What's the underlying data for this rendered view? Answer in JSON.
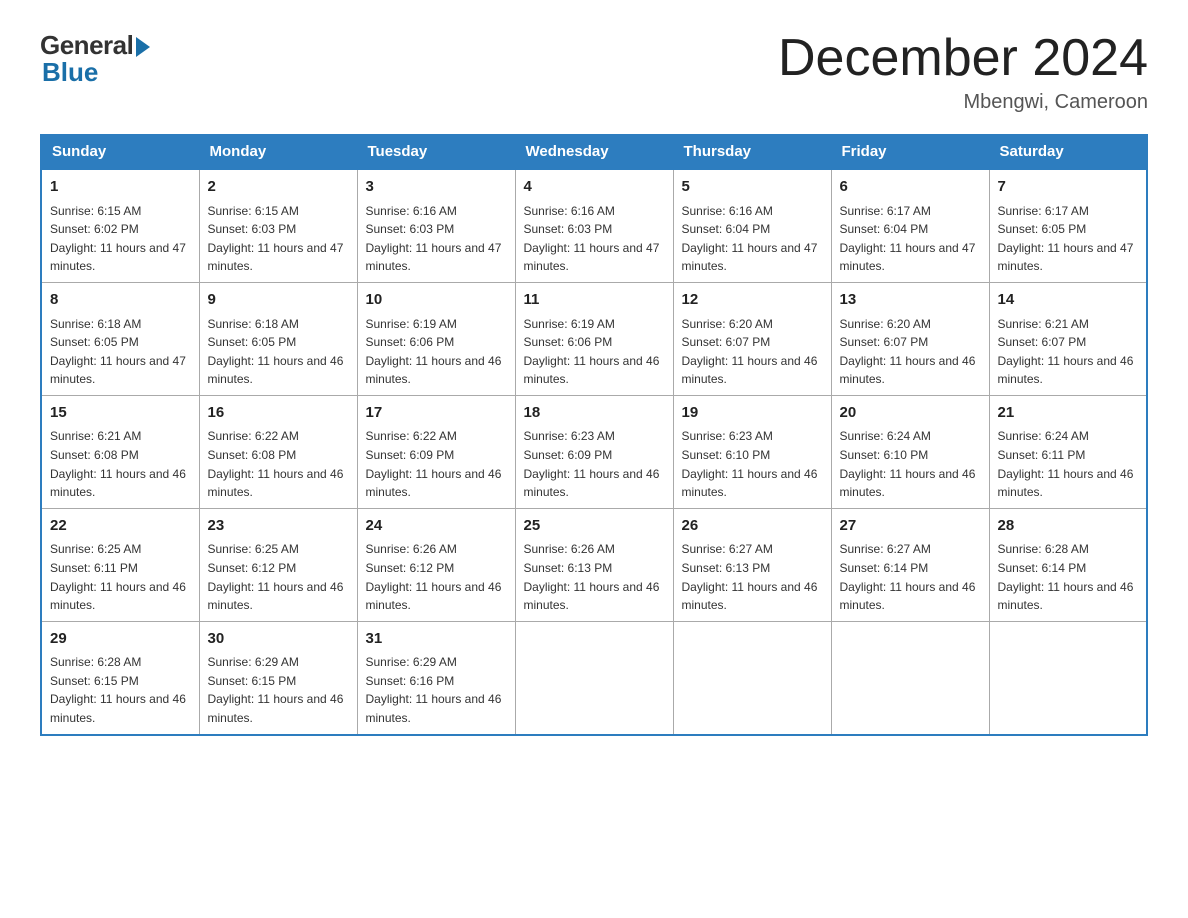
{
  "header": {
    "logo_general": "General",
    "logo_blue": "Blue",
    "month_title": "December 2024",
    "location": "Mbengwi, Cameroon"
  },
  "days_of_week": [
    "Sunday",
    "Monday",
    "Tuesday",
    "Wednesday",
    "Thursday",
    "Friday",
    "Saturday"
  ],
  "weeks": [
    [
      {
        "day": "1",
        "sunrise": "6:15 AM",
        "sunset": "6:02 PM",
        "daylight": "11 hours and 47 minutes."
      },
      {
        "day": "2",
        "sunrise": "6:15 AM",
        "sunset": "6:03 PM",
        "daylight": "11 hours and 47 minutes."
      },
      {
        "day": "3",
        "sunrise": "6:16 AM",
        "sunset": "6:03 PM",
        "daylight": "11 hours and 47 minutes."
      },
      {
        "day": "4",
        "sunrise": "6:16 AM",
        "sunset": "6:03 PM",
        "daylight": "11 hours and 47 minutes."
      },
      {
        "day": "5",
        "sunrise": "6:16 AM",
        "sunset": "6:04 PM",
        "daylight": "11 hours and 47 minutes."
      },
      {
        "day": "6",
        "sunrise": "6:17 AM",
        "sunset": "6:04 PM",
        "daylight": "11 hours and 47 minutes."
      },
      {
        "day": "7",
        "sunrise": "6:17 AM",
        "sunset": "6:05 PM",
        "daylight": "11 hours and 47 minutes."
      }
    ],
    [
      {
        "day": "8",
        "sunrise": "6:18 AM",
        "sunset": "6:05 PM",
        "daylight": "11 hours and 47 minutes."
      },
      {
        "day": "9",
        "sunrise": "6:18 AM",
        "sunset": "6:05 PM",
        "daylight": "11 hours and 46 minutes."
      },
      {
        "day": "10",
        "sunrise": "6:19 AM",
        "sunset": "6:06 PM",
        "daylight": "11 hours and 46 minutes."
      },
      {
        "day": "11",
        "sunrise": "6:19 AM",
        "sunset": "6:06 PM",
        "daylight": "11 hours and 46 minutes."
      },
      {
        "day": "12",
        "sunrise": "6:20 AM",
        "sunset": "6:07 PM",
        "daylight": "11 hours and 46 minutes."
      },
      {
        "day": "13",
        "sunrise": "6:20 AM",
        "sunset": "6:07 PM",
        "daylight": "11 hours and 46 minutes."
      },
      {
        "day": "14",
        "sunrise": "6:21 AM",
        "sunset": "6:07 PM",
        "daylight": "11 hours and 46 minutes."
      }
    ],
    [
      {
        "day": "15",
        "sunrise": "6:21 AM",
        "sunset": "6:08 PM",
        "daylight": "11 hours and 46 minutes."
      },
      {
        "day": "16",
        "sunrise": "6:22 AM",
        "sunset": "6:08 PM",
        "daylight": "11 hours and 46 minutes."
      },
      {
        "day": "17",
        "sunrise": "6:22 AM",
        "sunset": "6:09 PM",
        "daylight": "11 hours and 46 minutes."
      },
      {
        "day": "18",
        "sunrise": "6:23 AM",
        "sunset": "6:09 PM",
        "daylight": "11 hours and 46 minutes."
      },
      {
        "day": "19",
        "sunrise": "6:23 AM",
        "sunset": "6:10 PM",
        "daylight": "11 hours and 46 minutes."
      },
      {
        "day": "20",
        "sunrise": "6:24 AM",
        "sunset": "6:10 PM",
        "daylight": "11 hours and 46 minutes."
      },
      {
        "day": "21",
        "sunrise": "6:24 AM",
        "sunset": "6:11 PM",
        "daylight": "11 hours and 46 minutes."
      }
    ],
    [
      {
        "day": "22",
        "sunrise": "6:25 AM",
        "sunset": "6:11 PM",
        "daylight": "11 hours and 46 minutes."
      },
      {
        "day": "23",
        "sunrise": "6:25 AM",
        "sunset": "6:12 PM",
        "daylight": "11 hours and 46 minutes."
      },
      {
        "day": "24",
        "sunrise": "6:26 AM",
        "sunset": "6:12 PM",
        "daylight": "11 hours and 46 minutes."
      },
      {
        "day": "25",
        "sunrise": "6:26 AM",
        "sunset": "6:13 PM",
        "daylight": "11 hours and 46 minutes."
      },
      {
        "day": "26",
        "sunrise": "6:27 AM",
        "sunset": "6:13 PM",
        "daylight": "11 hours and 46 minutes."
      },
      {
        "day": "27",
        "sunrise": "6:27 AM",
        "sunset": "6:14 PM",
        "daylight": "11 hours and 46 minutes."
      },
      {
        "day": "28",
        "sunrise": "6:28 AM",
        "sunset": "6:14 PM",
        "daylight": "11 hours and 46 minutes."
      }
    ],
    [
      {
        "day": "29",
        "sunrise": "6:28 AM",
        "sunset": "6:15 PM",
        "daylight": "11 hours and 46 minutes."
      },
      {
        "day": "30",
        "sunrise": "6:29 AM",
        "sunset": "6:15 PM",
        "daylight": "11 hours and 46 minutes."
      },
      {
        "day": "31",
        "sunrise": "6:29 AM",
        "sunset": "6:16 PM",
        "daylight": "11 hours and 46 minutes."
      },
      null,
      null,
      null,
      null
    ]
  ],
  "sunrise_label": "Sunrise:",
  "sunset_label": "Sunset:",
  "daylight_label": "Daylight:"
}
